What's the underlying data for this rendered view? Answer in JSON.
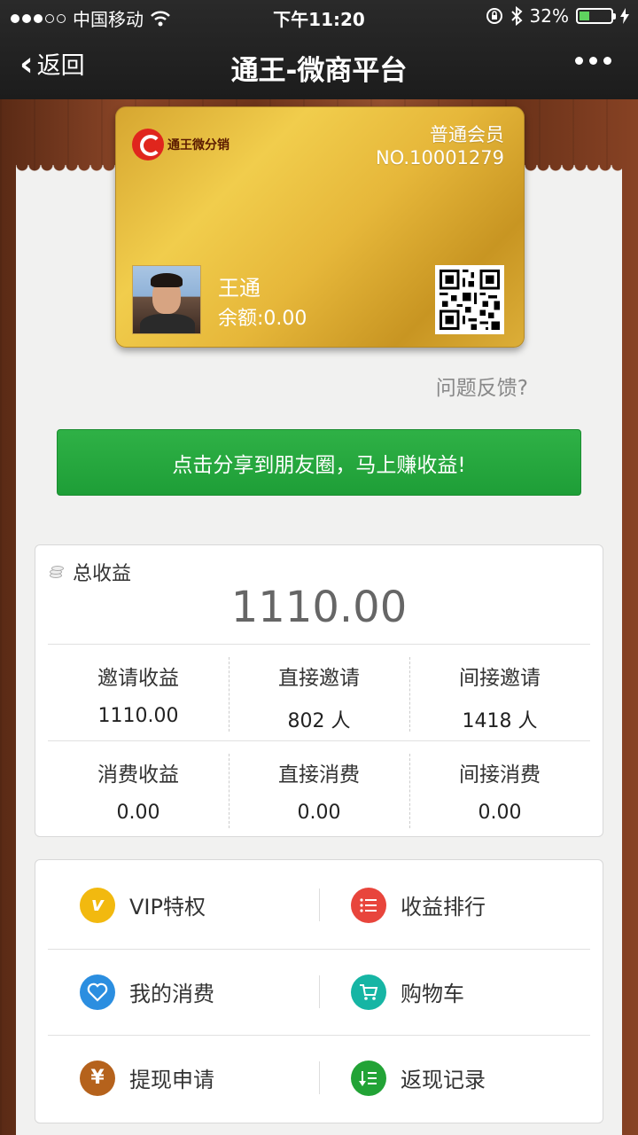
{
  "status_bar": {
    "carrier": "中国移动",
    "time": "下午11:20",
    "battery": "32%",
    "battery_level": 0.32
  },
  "nav": {
    "back_label": "返回",
    "title": "通王-微商平台"
  },
  "card": {
    "logo_text": "通王微分销",
    "level": "普通会员",
    "number": "NO.10001279",
    "name": "王通",
    "balance": "余额:0.00"
  },
  "feedback": "问题反馈?",
  "share_button": "点击分享到朋友圈，马上赚收益!",
  "earnings": {
    "title": "总收益",
    "total": "1110.00",
    "rows": [
      [
        {
          "label": "邀请收益",
          "value": "1110.00"
        },
        {
          "label": "直接邀请",
          "value": "802 人"
        },
        {
          "label": "间接邀请",
          "value": "1418 人"
        }
      ],
      [
        {
          "label": "消费收益",
          "value": "0.00"
        },
        {
          "label": "直接消费",
          "value": "0.00"
        },
        {
          "label": "间接消费",
          "value": "0.00"
        }
      ]
    ]
  },
  "menu": [
    [
      {
        "label": "VIP特权",
        "icon": "vip-icon",
        "color": "#f2b90f"
      },
      {
        "label": "收益排行",
        "icon": "ranking-list-icon",
        "color": "#e8453c"
      }
    ],
    [
      {
        "label": "我的消费",
        "icon": "heart-icon",
        "color": "#2b8ee0"
      },
      {
        "label": "购物车",
        "icon": "shopping-cart-icon",
        "color": "#16b5a4"
      }
    ],
    [
      {
        "label": "提现申请",
        "icon": "yuan-icon",
        "color": "#b5621c"
      },
      {
        "label": "返现记录",
        "icon": "record-list-icon",
        "color": "#22a336"
      }
    ]
  ]
}
